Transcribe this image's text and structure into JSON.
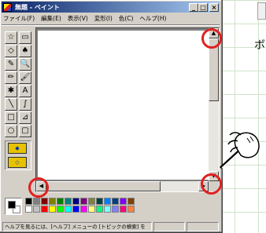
{
  "window": {
    "title": "無題 - ペイント",
    "min_label": "_",
    "max_label": "□",
    "close_label": "×"
  },
  "menu": {
    "items": [
      {
        "label": "ファイル(F)"
      },
      {
        "label": "編集(E)"
      },
      {
        "label": "表示(V)"
      },
      {
        "label": "変形(I)"
      },
      {
        "label": "色(C)"
      },
      {
        "label": "ヘルプ(H)"
      }
    ]
  },
  "toolbox": {
    "tools": [
      {
        "icon": "free-select-icon",
        "glyph": "☆"
      },
      {
        "icon": "rect-select-icon",
        "glyph": "▭"
      },
      {
        "icon": "eraser-icon",
        "glyph": "◇"
      },
      {
        "icon": "fill-icon",
        "glyph": "♠"
      },
      {
        "icon": "eyedropper-icon",
        "glyph": "✎"
      },
      {
        "icon": "magnifier-icon",
        "glyph": "🔍"
      },
      {
        "icon": "pencil-icon",
        "glyph": "✏"
      },
      {
        "icon": "brush-icon",
        "glyph": "🖌"
      },
      {
        "icon": "airbrush-icon",
        "glyph": "✱"
      },
      {
        "icon": "text-icon",
        "glyph": "A"
      },
      {
        "icon": "line-icon",
        "glyph": "╲"
      },
      {
        "icon": "curve-icon",
        "glyph": "∫"
      },
      {
        "icon": "rectangle-icon",
        "glyph": "□"
      },
      {
        "icon": "polygon-icon",
        "glyph": "⊿"
      },
      {
        "icon": "ellipse-icon",
        "glyph": "○"
      },
      {
        "icon": "rounded-rect-icon",
        "glyph": "▢"
      }
    ],
    "options": [
      {
        "icon": "opaque-option-icon",
        "glyph": "◆"
      },
      {
        "icon": "transparent-option-icon",
        "glyph": "◇"
      }
    ]
  },
  "scrollbars": {
    "up_arrow": "▲",
    "down_arrow": "▼",
    "left_arrow": "◀",
    "right_arrow": "▶"
  },
  "palette": {
    "foreground": "#000000",
    "background": "#ffffff",
    "colors_row1": [
      "#000000",
      "#808080",
      "#800000",
      "#808000",
      "#008000",
      "#008080",
      "#000080",
      "#800080",
      "#808040",
      "#004040",
      "#0080ff",
      "#004080",
      "#8000ff",
      "#804000"
    ],
    "colors_row2": [
      "#ffffff",
      "#c0c0c0",
      "#ff0000",
      "#ffff00",
      "#00ff00",
      "#00ffff",
      "#0000ff",
      "#ff00ff",
      "#ffff80",
      "#00ff80",
      "#80ffff",
      "#8080ff",
      "#ff0080",
      "#ff8040"
    ]
  },
  "statusbar": {
    "text": "ヘルプを見るには、[ヘルプ] メニューの [トピックの検索] を"
  },
  "right_window": {
    "text": "ボ"
  },
  "colors": {
    "highlight": "#e02020",
    "titlebar_start": "#0a246a",
    "titlebar_end": "#a6caf0"
  }
}
